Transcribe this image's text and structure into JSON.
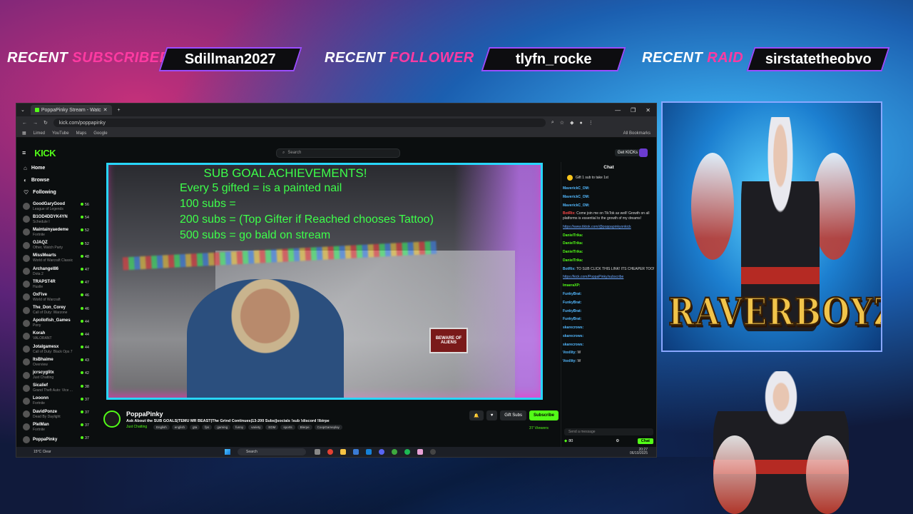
{
  "banner": {
    "subscriber_label_a": "RECENT ",
    "subscriber_label_b": "SUBSCRIBER",
    "subscriber_name": "Sdillman2027",
    "follower_label_a": "RECENT ",
    "follower_label_b": "FOLLOWER",
    "follower_name": "tlyfn_rocke",
    "raid_label_a": "RECENT ",
    "raid_label_b": "RAID",
    "raid_name": "sirstatetheobvo"
  },
  "browser": {
    "tab_title": "PoppaPinky Stream - Watc",
    "url": "kick.com/poppapinky",
    "bookmarks": [
      "Limed",
      "YouTube",
      "Maps",
      "Google"
    ],
    "all_bookmarks": "All Bookmarks"
  },
  "kick": {
    "logo": "KICK",
    "search_placeholder": "Search",
    "get_kicks": "Get KICKs",
    "nav": {
      "home": "Home",
      "browse": "Browse",
      "following": "Following"
    },
    "channels": [
      {
        "name": "GoodGaryGood",
        "game": "League of Legends",
        "count": "56"
      },
      {
        "name": "B1OD4DDYK4YN",
        "game": "Schedule I",
        "count": "54"
      },
      {
        "name": "Maintainyaedeme",
        "game": "Fortnite",
        "count": "52"
      },
      {
        "name": "OJAQZ",
        "game": "Other, Watch Party",
        "count": "52"
      },
      {
        "name": "MissMearts",
        "game": "World of Warcraft Classic",
        "count": "48"
      },
      {
        "name": "Archangel86",
        "game": "Dota 2",
        "count": "47"
      },
      {
        "name": "TRAPST4R",
        "game": "Hustle",
        "count": "47"
      },
      {
        "name": "OxFive",
        "game": "World of Warcraft",
        "count": "46"
      },
      {
        "name": "The_Don_Corey",
        "game": "Call of Duty: Warzone",
        "count": "46"
      },
      {
        "name": "Apollofish_Games",
        "game": "Pony",
        "count": "44"
      },
      {
        "name": "Korah",
        "game": "VALORANT",
        "count": "44"
      },
      {
        "name": "Jotalgamesx",
        "game": "Call of Duty: Black Ops 7",
        "count": "44"
      },
      {
        "name": "ItsBhaime",
        "game": "Overview",
        "count": "43"
      },
      {
        "name": "jcrscyglitx",
        "game": "Just Chatting",
        "count": "42"
      },
      {
        "name": "Sicalief",
        "game": "Grand Theft Auto: Vice ...",
        "count": "38"
      },
      {
        "name": "Looonn",
        "game": "Fortnite",
        "count": "37"
      },
      {
        "name": "DavidPonze",
        "game": "Dead By Daylight",
        "count": "37"
      },
      {
        "name": "PlelMan",
        "game": "Fortnite",
        "count": "37"
      },
      {
        "name": "PoppaPinky",
        "game": "",
        "count": "37"
      }
    ]
  },
  "stream": {
    "overlay_title": "SUB GOAL ACHIEVEMENTS!",
    "overlay_lines": [
      "Every 5 gifted = is a painted nail",
      "100 subs =",
      "200 subs = (Top Gifter if Reached chooses Tattoo)",
      "500 subs = go bald on stream"
    ],
    "sign_text": "BEWARE OF ALIENS",
    "channel": "PoppaPinky",
    "title": "Ask About the SUB GOALS|TEMU MR BEAST|The Grind Continues|13-200 Subs||socials !sub !discord !lbirpe",
    "category": "Just Chatting",
    "tags": [
      "English",
      "english",
      "gta",
      "fps",
      "gaming",
      "funny",
      "variety",
      "EDM",
      "sports",
      "Blerpe",
      "CoopGameplay"
    ],
    "gift_subs": "Gift Subs",
    "subscribe": "Subscribe",
    "viewers": "37 Viewers"
  },
  "chat": {
    "header": "Chat",
    "pinned": "Gift 1 sub to take 1st",
    "messages": [
      {
        "user": "MaverickC_OM:",
        "text": "",
        "color": "b"
      },
      {
        "user": "MaverickC_OM:",
        "text": "",
        "color": "b"
      },
      {
        "user": "MaverickC_OM:",
        "text": "",
        "color": "b"
      },
      {
        "user": "BotRix:",
        "text": "Come join me on TikTok as well! Growth on all platforms is essential to the growth of my dreams!",
        "color": "r"
      },
      {
        "user": "",
        "text": "https://www.tiktok.com/@poppapinkyonkick",
        "color": "l"
      },
      {
        "user": "DanielTrika:",
        "text": "",
        "color": "g"
      },
      {
        "user": "DanielTrika:",
        "text": "",
        "color": "g"
      },
      {
        "user": "DanielTrika:",
        "text": "",
        "color": "g"
      },
      {
        "user": "DanielTrika:",
        "text": "",
        "color": "g"
      },
      {
        "user": "BotRix:",
        "text": "TO SUB CLICK THIS LINK! ITS CHEAPER TOO!",
        "color": "b"
      },
      {
        "user": "",
        "text": "https://kick.com/PoppaPinky/subscribe",
        "color": "l"
      },
      {
        "user": "ImaeraXP:",
        "text": "",
        "color": "g"
      },
      {
        "user": "FunkyBrat:",
        "text": "",
        "color": "b"
      },
      {
        "user": "FunkyBrat:",
        "text": "",
        "color": "b"
      },
      {
        "user": "FunkyBrat:",
        "text": "",
        "color": "b"
      },
      {
        "user": "FunkyBrat:",
        "text": "",
        "color": "b"
      },
      {
        "user": "skarecrows:",
        "text": "",
        "color": "b"
      },
      {
        "user": "skarecrows:",
        "text": "",
        "color": "b"
      },
      {
        "user": "skarecrows:",
        "text": "",
        "color": "b"
      },
      {
        "user": "Voxility:",
        "text": "W",
        "color": "b"
      },
      {
        "user": "Voxility:",
        "text": "W",
        "color": "b"
      }
    ],
    "input_placeholder": "Send a message",
    "points": "80",
    "send": "Chat"
  },
  "taskbar": {
    "temp": "15°C",
    "weather": "Clear",
    "search": "Search",
    "time": "20:27",
    "date": "06/10/2025"
  },
  "brand": {
    "logo_text": "RAVERBOYZ"
  },
  "colors": {
    "kick_green": "#53fc18",
    "overlay_green": "#3dff4a",
    "accent_pink": "#ff3aa2"
  }
}
